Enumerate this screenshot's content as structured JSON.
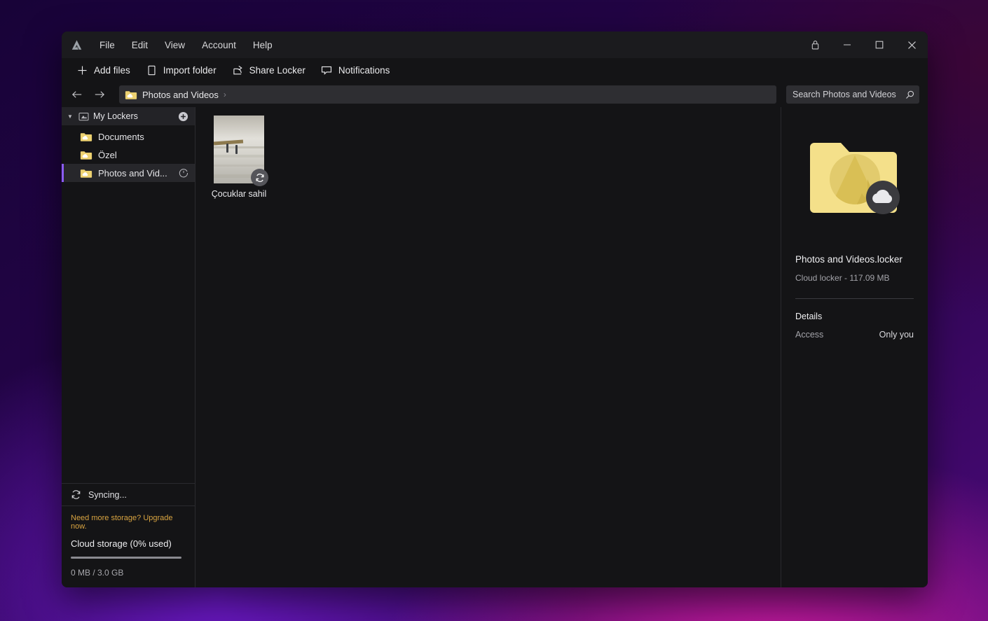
{
  "window": {
    "menu": [
      {
        "label": "File"
      },
      {
        "label": "Edit"
      },
      {
        "label": "View"
      },
      {
        "label": "Account"
      },
      {
        "label": "Help"
      }
    ],
    "controls": {
      "lock": "lock-icon",
      "minimize": "minimize-icon",
      "maximize": "maximize-icon",
      "close": "close-icon"
    }
  },
  "toolbar": {
    "buttons": [
      {
        "label": "Add files",
        "icon": "plus-icon"
      },
      {
        "label": "Import folder",
        "icon": "folder-import-icon"
      },
      {
        "label": "Share Locker",
        "icon": "share-icon"
      },
      {
        "label": "Notifications",
        "icon": "notification-icon"
      }
    ]
  },
  "nav": {
    "back": "back-arrow-icon",
    "forward": "forward-arrow-icon",
    "breadcrumb": {
      "label": "Photos and Videos",
      "separator": "›",
      "icon": "folder-cloud-icon"
    }
  },
  "search": {
    "placeholder": "Search Photos and Videos",
    "value": "",
    "icon": "search-icon"
  },
  "sidebar": {
    "header": {
      "title": "My Lockers",
      "chevron": "chevron-down-icon",
      "add_icon": "add-locker-icon"
    },
    "items": [
      {
        "label": "Documents",
        "icon": "folder-cloud-icon",
        "selected": false,
        "status": ""
      },
      {
        "label": "Özel",
        "icon": "folder-cloud-icon",
        "selected": false,
        "status": ""
      },
      {
        "label": "Photos and Vid...",
        "icon": "folder-cloud-icon",
        "selected": true,
        "status": "pending-clock-icon"
      }
    ],
    "sync": {
      "label": "Syncing...",
      "icon": "sync-icon"
    },
    "storage": {
      "upgrade_text": "Need more storage? Upgrade now.",
      "title": "Cloud storage (0% used)",
      "used_text": "0 MB / 3.0 GB",
      "percent": 0
    }
  },
  "content": {
    "files": [
      {
        "name": "Çocuklar sahil",
        "badge": "sync-icon",
        "thumbnail": "beach-photo-thumbnail"
      }
    ]
  },
  "details": {
    "icon": "locker-folder-cloud-icon",
    "title": "Photos and Videos.locker",
    "subtitle": "Cloud locker - 117.09 MB",
    "heading": "Details",
    "rows": [
      {
        "key": "Access",
        "value": "Only you"
      }
    ]
  },
  "colors": {
    "accent": "#8b5cf6",
    "upgrade": "#d9a441",
    "folder": "#f4e08a",
    "window_bg": "#141416"
  }
}
